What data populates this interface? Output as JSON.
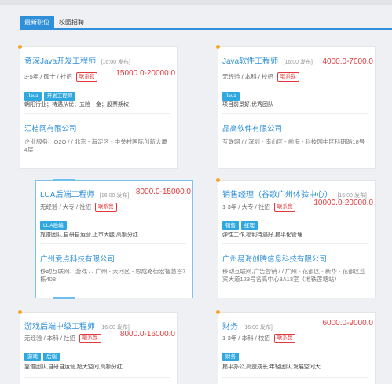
{
  "tabs": [
    {
      "label": "最新职位",
      "active": true
    },
    {
      "label": "校园招聘",
      "active": false
    }
  ],
  "jobs": [
    {
      "title": "资深Java开发工程师",
      "posted": "[16:00 发布]",
      "salary": "15000.0-20000.0",
      "meta": "3-5年 / 硕士 / 社招",
      "contact": "联系我",
      "tags": [
        "Java",
        "开发工程师"
      ],
      "benefits": "朝阳行业；待遇从优；五险一金；股票期权",
      "company": "汇桔网有限公司",
      "company_info": "企业服务、O2O / / 北京 - 海淀区 - 中关村国际创新大厦4层"
    },
    {
      "title": "Java软件工程师",
      "posted": "[16:00 发布]",
      "salary": "4000.0-7000.0",
      "meta": "无经验 / 本科 / 校招",
      "contact": "联系我",
      "tags": [
        "Java"
      ],
      "benefits": "项目前景好,优秀团队",
      "company": "品高软件有限公司",
      "company_info": "互联网 / / 深圳 - 南山区 - 前海 - 科技园中区科研路18号"
    },
    {
      "title": "LUA后端工程师",
      "posted": "[16:00 发布]",
      "salary": "8000.0-15000.0",
      "meta": "无经验 / 大专 / 社招",
      "contact": "联系我",
      "tags": [
        "LUA后端"
      ],
      "benefits": "靠谱团队,自研自运营,上市大腿,高额分红",
      "company": "广州爱点科技有限公司",
      "company_info": "移动互联网、游戏 / / 广州 - 天河区 - 思成路街宏智慧谷7栋408"
    },
    {
      "title": "销售经理（谷歌广州体验中心）",
      "posted": "[16:00 发布]",
      "salary": "10000.0-20000.0",
      "meta": "1-3年 / 大专 / 社招",
      "contact": "联系我",
      "tags": [
        "销售",
        "经理"
      ],
      "benefits": "弹性工作,福利待遇好,扁平化管理",
      "company": "广州易海创腾信息科技有限公司",
      "company_info": "移动互联网,广告营销 / / 广州 - 花都区 - 新华 - 花都区迎宾大道123号名高中心3A13室（地铁莲塘站）"
    },
    {
      "title": "游戏后端中级工程师",
      "posted": "[16:00 发布]",
      "salary": "8000.0-16000.0",
      "meta": "无经验 / 本科 / 社招",
      "contact": "联系我",
      "tags": [
        "游戏",
        "后端"
      ],
      "benefits": "靠谱团队,自研自运营,超大空间,高额分红"
    },
    {
      "title": "财务",
      "posted": "[16:00 发布]",
      "salary": "6000.0-9000.0",
      "meta": "1-3年 / 本科 / 校招",
      "contact": "联系我",
      "tags": [
        "财务"
      ],
      "benefits": "扁平办公,高速成长,年轻团队,发展空间大"
    }
  ]
}
